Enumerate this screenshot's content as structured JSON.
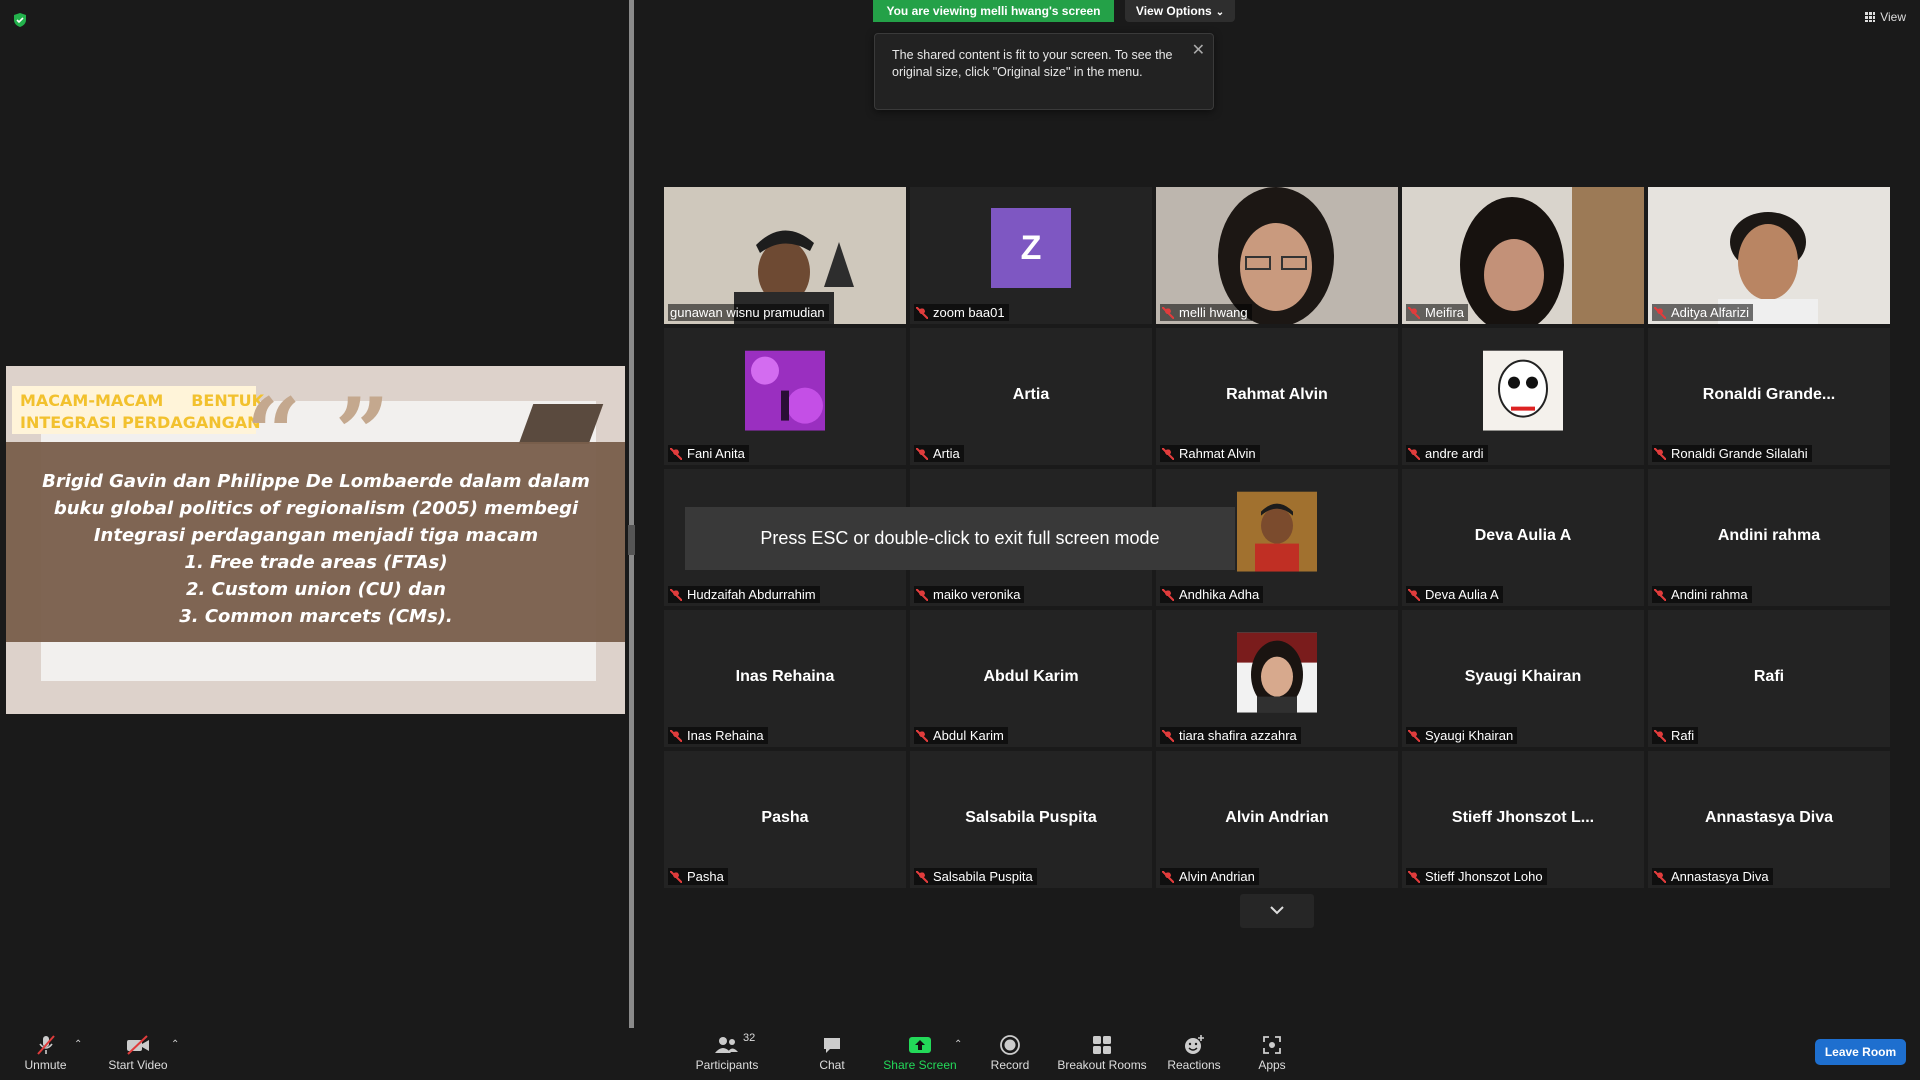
{
  "share_panel": {
    "slide": {
      "header_line1": "MACAM-MACAM     BENTUK",
      "header_line2": "INTEGRASI PERDAGANGAN",
      "quote_marks": "“ ”",
      "body_lines": [
        "Brigid Gavin dan Philippe De Lombaerde dalam dalam",
        "buku global politics of regionalism (2005) membegi",
        "Integrasi perdagangan menjadi tiga macam",
        "1. Free trade areas (FTAs)",
        "2. Custom union (CU) dan",
        "3. Common marcets (CMs)."
      ]
    }
  },
  "banner": {
    "viewing_text": "You are viewing melli hwang's screen",
    "view_options": "View Options"
  },
  "tooltip": {
    "text": "The shared content is fit to your screen. To see the original size, click \"Original size\" in the menu."
  },
  "view_button": "View",
  "esc_message": "Press ESC or double-click to exit full screen mode",
  "esc_hidden_tile_text": "Hudza",
  "participants": [
    {
      "name": "gunawan wisnu pramudian",
      "display": "",
      "type": "video",
      "active": true
    },
    {
      "name": "zoom baa01",
      "display": "Z",
      "type": "letter"
    },
    {
      "name": "melli hwang",
      "display": "",
      "type": "video"
    },
    {
      "name": "Meifira",
      "display": "",
      "type": "video"
    },
    {
      "name": "Aditya Alfarizi",
      "display": "",
      "type": "video"
    },
    {
      "name": "Fani Anita",
      "display": "",
      "type": "thumb-purple"
    },
    {
      "name": "Artia",
      "display": "Artia",
      "type": "name"
    },
    {
      "name": "Rahmat Alvin",
      "display": "Rahmat Alvin",
      "type": "name"
    },
    {
      "name": "andre ardi",
      "display": "",
      "type": "thumb-drawing"
    },
    {
      "name": "Ronaldi Grande Silalahi",
      "display": "Ronaldi  Grande...",
      "type": "name"
    },
    {
      "name": "Hudzaifah Abdurrahim",
      "display": "",
      "type": "name"
    },
    {
      "name": "maiko veronika",
      "display": "",
      "type": "name"
    },
    {
      "name": "Andhika Adha",
      "display": "",
      "type": "thumb-photo"
    },
    {
      "name": "Deva Aulia A",
      "display": "Deva Aulia A",
      "type": "name"
    },
    {
      "name": "Andini rahma",
      "display": "Andini rahma",
      "type": "name"
    },
    {
      "name": "Inas Rehaina",
      "display": "Inas Rehaina",
      "type": "name"
    },
    {
      "name": "Abdul Karim",
      "display": "Abdul Karim",
      "type": "name"
    },
    {
      "name": "tiara shafira azzahra",
      "display": "",
      "type": "thumb-girl"
    },
    {
      "name": "Syaugi Khairan",
      "display": "Syaugi Khairan",
      "type": "name"
    },
    {
      "name": "Rafi",
      "display": "Rafi",
      "type": "name"
    },
    {
      "name": "Pasha",
      "display": "Pasha",
      "type": "name"
    },
    {
      "name": "Salsabila Puspita",
      "display": "Salsabila Puspita",
      "type": "name"
    },
    {
      "name": "Alvin Andrian",
      "display": "Alvin Andrian",
      "type": "name"
    },
    {
      "name": "Stieff Jhonszot Loho",
      "display": "Stieff  Jhonszot  L...",
      "type": "name"
    },
    {
      "name": "Annastasya Diva",
      "display": "Annastasya Diva",
      "type": "name"
    }
  ],
  "toolbar": {
    "unmute": "Unmute",
    "start_video": "Start Video",
    "participants": "Participants",
    "participants_count": "32",
    "chat": "Chat",
    "share_screen": "Share Screen",
    "record": "Record",
    "breakout_rooms": "Breakout Rooms",
    "reactions": "Reactions",
    "apps": "Apps",
    "leave_room": "Leave Room"
  },
  "colors": {
    "banner_green": "#24a148",
    "share_green": "#23d959",
    "leave_blue": "#1e6fcf",
    "active_speaker": "#d8e86a",
    "muted_red": "#e03c3c"
  }
}
